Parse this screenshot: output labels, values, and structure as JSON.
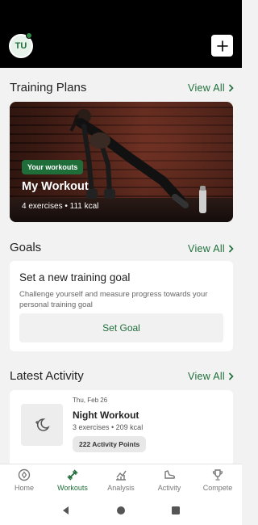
{
  "header": {
    "avatar_initials": "TU",
    "add_icon": "plus-icon"
  },
  "training_plans": {
    "title": "Training Plans",
    "view_all": "View All",
    "card": {
      "badge": "Your workouts",
      "title": "My Workout",
      "meta": "4 exercises • 111 kcal"
    }
  },
  "goals": {
    "title": "Goals",
    "view_all": "View All",
    "card": {
      "heading": "Set a new training goal",
      "description": "Challenge yourself and measure progress towards your personal training goal",
      "button": "Set Goal"
    }
  },
  "latest_activity": {
    "title": "Latest Activity",
    "view_all": "View All",
    "item": {
      "date": "Thu, Feb 26",
      "name": "Night Workout",
      "meta": "3 exercises • 209 kcal",
      "points": "222 Activity Points",
      "icon": "moon-stars-icon"
    }
  },
  "bottom_nav": {
    "items": [
      {
        "label": "Home",
        "icon": "compass-icon",
        "active": false
      },
      {
        "label": "Workouts",
        "icon": "dumbbell-icon",
        "active": true
      },
      {
        "label": "Analysis",
        "icon": "chart-icon",
        "active": false
      },
      {
        "label": "Activity",
        "icon": "shoe-icon",
        "active": false
      },
      {
        "label": "Compete",
        "icon": "trophy-icon",
        "active": false
      }
    ]
  },
  "colors": {
    "accent": "#1f6e3a",
    "background": "#f2f2f2",
    "topbar": "#000000"
  }
}
